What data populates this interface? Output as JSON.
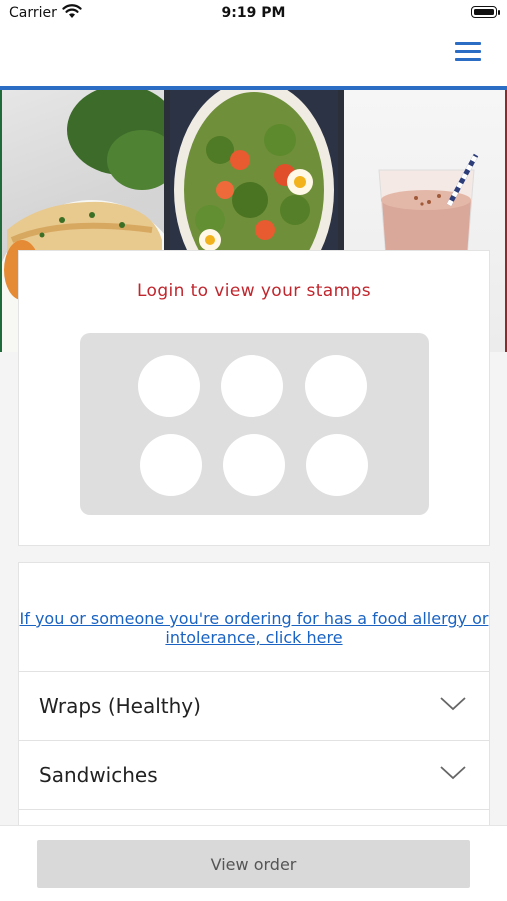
{
  "status_bar": {
    "carrier": "Carrier",
    "time": "9:19 PM"
  },
  "header": {
    "menu_icon": "hamburger-menu-icon",
    "accent_color": "#2b6cc4"
  },
  "banner": {
    "images": [
      "fish-dish-image",
      "salad-image",
      "smoothie-image"
    ]
  },
  "stamps": {
    "title": "Login to view your stamps",
    "stamp_count": 6,
    "title_color": "#c0262d"
  },
  "allergy_notice": {
    "text": "If you or someone you're ordering for has a food allergy or intolerance, click here"
  },
  "menu_categories": [
    {
      "label": "Wraps (Healthy)",
      "icon": "chevron-down-icon"
    },
    {
      "label": "Sandwiches",
      "icon": "chevron-down-icon"
    }
  ],
  "footer": {
    "view_order_label": "View order"
  }
}
